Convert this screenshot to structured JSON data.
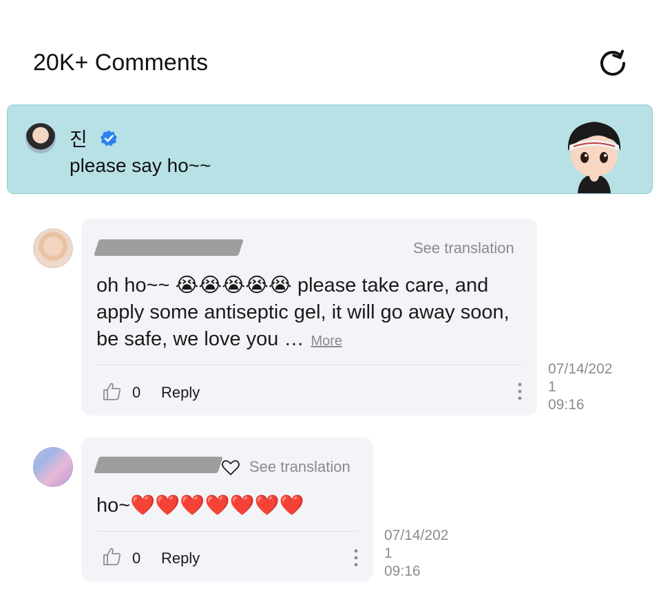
{
  "header": {
    "title": "20K+ Comments",
    "refresh_icon": "refresh-icon"
  },
  "pinned": {
    "author": "진",
    "verified_icon": "verified-badge-icon",
    "text": "please say ho~~",
    "background": "#b8e1e6"
  },
  "comments": [
    {
      "translate_label": "See translation",
      "text": "oh ho~~ 😭😭😭😭😭 please take care, and apply some antiseptic gel, it will go away soon, be safe, we love you …",
      "more_label": "More",
      "likes": "0",
      "reply_label": "Reply",
      "timestamp": "07/14/202\n1\n09:16"
    },
    {
      "translate_label": "See translation",
      "text": "ho~❤️❤️❤️❤️❤️❤️❤️",
      "likes": "0",
      "reply_label": "Reply",
      "timestamp": "07/14/202\n1\n09:16"
    }
  ],
  "colors": {
    "bubble": "#f3f4f8",
    "muted_text": "#888a8f",
    "verified_blue": "#2f80ed"
  }
}
